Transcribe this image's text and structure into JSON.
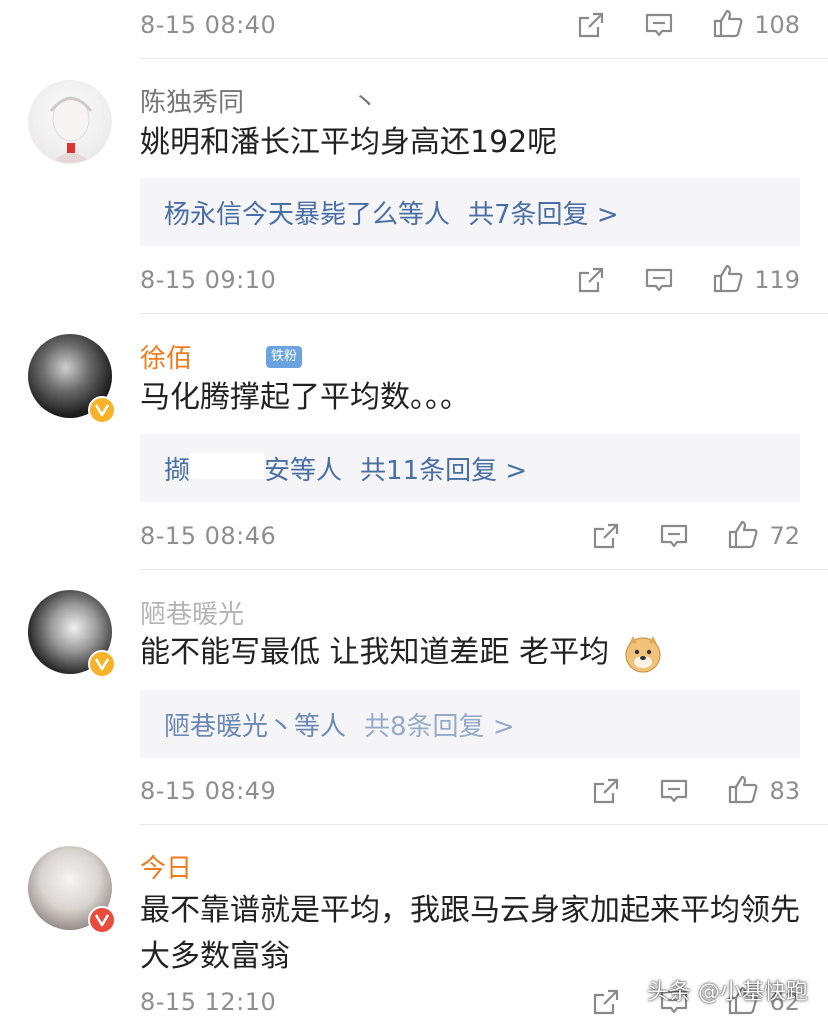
{
  "comments": [
    {
      "time": "8-15 08:40",
      "likes": "108"
    },
    {
      "username": "陈独秀同",
      "username_tail": "丶",
      "content": "姚明和潘长江平均身高还192呢",
      "reply_names": "杨永信今天暴毙了么等人",
      "reply_count": "共7条回复 >",
      "time": "8-15 09:10",
      "likes": "119"
    },
    {
      "username": "徐佰",
      "fan_badge": "铁粉",
      "content": "马化腾撑起了平均数。。。",
      "reply_names_prefix": "撷",
      "reply_names_suffix": "安等人",
      "reply_count": "共11条回复 >",
      "time": "8-15 08:46",
      "likes": "72"
    },
    {
      "username": "陋巷暖光",
      "content": "能不能写最低 让我知道差距 老平均",
      "reply_names": "陋巷暖光丶等人",
      "reply_count": "共8条回复 >",
      "time": "8-15 08:49",
      "likes": "83"
    },
    {
      "username": "今日",
      "content_line1": "最不靠谱就是平均，我跟马云身家加起来平均领先",
      "content_line2": "大多数富翁",
      "time": "8-15 12:10",
      "likes": "62"
    }
  ],
  "watermark": "头条 @小基快跑",
  "colors": {
    "link": "#4a6fa5",
    "username_vip": "#f07a1c",
    "meta": "#8e8e8e",
    "badge_gold": "#f6b329"
  },
  "icons": [
    "share-icon",
    "reply-icon",
    "thumbs-up-icon",
    "verified-badge-icon",
    "doge-emoji-icon"
  ]
}
